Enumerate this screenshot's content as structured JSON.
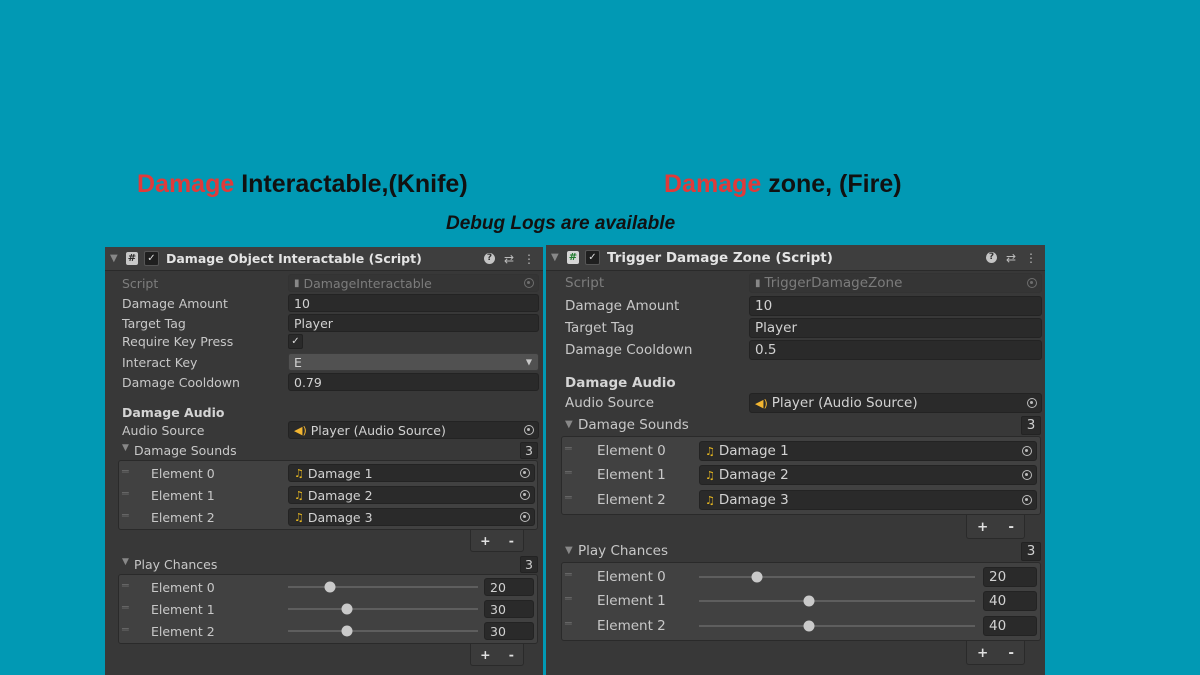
{
  "headings": {
    "left": {
      "red": "Damage",
      "rest": "Interactable,(Knife)"
    },
    "right": {
      "red": "Damage",
      "rest": "zone, (Fire)"
    },
    "subtitle": "Debug Logs are available"
  },
  "colors": {
    "background": "#0199b4",
    "accent_red": "#e03a3a",
    "panel": "#383838"
  },
  "left_panel": {
    "title": "Damage Object Interactable (Script)",
    "icons": [
      "fold-arrow-icon",
      "script-icon",
      "enabled-checkbox",
      "help-icon",
      "preset-icon",
      "kebab-menu-icon"
    ],
    "script_label": "Script",
    "script_value": "DamageInteractable",
    "damage_amount_label": "Damage Amount",
    "damage_amount": "10",
    "target_tag_label": "Target Tag",
    "target_tag": "Player",
    "require_key_label": "Require Key Press",
    "require_key": true,
    "interact_key_label": "Interact Key",
    "interact_key": "E",
    "cooldown_label": "Damage Cooldown",
    "cooldown": "0.79",
    "audio_header": "Damage Audio",
    "audio_source_label": "Audio Source",
    "audio_source": "Player (Audio Source)",
    "sounds_label": "Damage Sounds",
    "sounds_count": "3",
    "sounds": [
      {
        "label": "Element 0",
        "value": "Damage 1"
      },
      {
        "label": "Element 1",
        "value": "Damage 2"
      },
      {
        "label": "Element 2",
        "value": "Damage 3"
      }
    ],
    "chances_label": "Play Chances",
    "chances_count": "3",
    "chances": [
      {
        "label": "Element 0",
        "value": "20",
        "fraction": 0.22
      },
      {
        "label": "Element 1",
        "value": "30",
        "fraction": 0.31
      },
      {
        "label": "Element 2",
        "value": "30",
        "fraction": 0.31
      }
    ],
    "plus": "+",
    "minus": "-"
  },
  "right_panel": {
    "title": "Trigger Damage Zone (Script)",
    "script_label": "Script",
    "script_value": "TriggerDamageZone",
    "damage_amount_label": "Damage Amount",
    "damage_amount": "10",
    "target_tag_label": "Target Tag",
    "target_tag": "Player",
    "cooldown_label": "Damage Cooldown",
    "cooldown": "0.5",
    "audio_header": "Damage Audio",
    "audio_source_label": "Audio Source",
    "audio_source": "Player (Audio Source)",
    "sounds_label": "Damage Sounds",
    "sounds_count": "3",
    "sounds": [
      {
        "label": "Element 0",
        "value": "Damage 1"
      },
      {
        "label": "Element 1",
        "value": "Damage 2"
      },
      {
        "label": "Element 2",
        "value": "Damage 3"
      }
    ],
    "chances_label": "Play Chances",
    "chances_count": "3",
    "chances": [
      {
        "label": "Element 0",
        "value": "20",
        "fraction": 0.21
      },
      {
        "label": "Element 1",
        "value": "40",
        "fraction": 0.4
      },
      {
        "label": "Element 2",
        "value": "40",
        "fraction": 0.4
      }
    ],
    "plus": "+",
    "minus": "-"
  }
}
